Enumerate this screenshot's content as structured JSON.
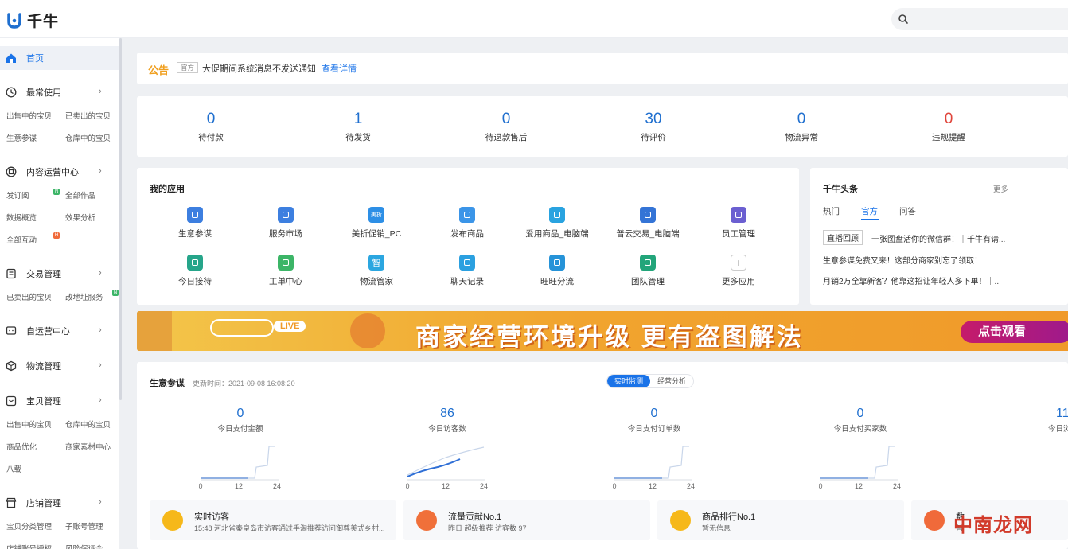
{
  "brand": {
    "name": "千牛"
  },
  "search": {
    "placeholder": ""
  },
  "sidebar": {
    "home": "首页",
    "sections": [
      {
        "title": "最常使用",
        "icon": "clock-icon",
        "items": [
          "出售中的宝贝",
          "已卖出的宝贝",
          "生意参谋",
          "仓库中的宝贝"
        ]
      },
      {
        "title": "内容运营中心",
        "icon": "content-icon",
        "items": [
          "发订阅",
          "全部作品",
          "数据概览",
          "效果分析",
          "全部互动"
        ]
      },
      {
        "title": "交易管理",
        "icon": "order-icon",
        "items": [
          "已卖出的宝贝",
          "改地址服务"
        ]
      },
      {
        "title": "自运营中心",
        "icon": "chat-icon",
        "items": []
      },
      {
        "title": "物流管理",
        "icon": "box-icon",
        "items": []
      },
      {
        "title": "宝贝管理",
        "icon": "goods-icon",
        "items": [
          "出售中的宝贝",
          "仓库中的宝贝",
          "商品优化",
          "商家素材中心",
          "八载"
        ]
      },
      {
        "title": "店铺管理",
        "icon": "store-icon",
        "items": [
          "宝贝分类管理",
          "子账号管理",
          "店铺账号授权",
          "风险保证金"
        ]
      }
    ],
    "badges": {
      "new": "N",
      "hot": "H"
    }
  },
  "notice": {
    "label": "公告",
    "tag": "官方",
    "message": "大促期间系统消息不发送通知",
    "link": "查看详情"
  },
  "stats": [
    {
      "value": "0",
      "label": "待付款"
    },
    {
      "value": "1",
      "label": "待发货"
    },
    {
      "value": "0",
      "label": "待退款售后"
    },
    {
      "value": "30",
      "label": "待评价"
    },
    {
      "value": "0",
      "label": "物流异常"
    },
    {
      "value": "0",
      "label": "违规提醒"
    }
  ],
  "apps": {
    "title": "我的应用",
    "items": [
      {
        "label": "生意参谋",
        "color": "#3d7fe0",
        "icon": "compass-icon"
      },
      {
        "label": "服务市场",
        "color": "#3d7fe0",
        "icon": "bag-icon"
      },
      {
        "label": "美折促销_PC",
        "color": "#2d8fe6",
        "icon": "tag-icon",
        "glyph": "美折"
      },
      {
        "label": "发布商品",
        "color": "#3b95e8",
        "icon": "send-icon"
      },
      {
        "label": "爱用商品_电脑端",
        "color": "#29a3e0",
        "icon": "goods-edit-icon"
      },
      {
        "label": "普云交易_电脑端",
        "color": "#3474d6",
        "icon": "money-icon"
      },
      {
        "label": "员工管理",
        "color": "#6b5fd1",
        "icon": "staff-icon"
      },
      {
        "label": "今日接待",
        "color": "#26a58a",
        "icon": "user-icon"
      },
      {
        "label": "工单中心",
        "color": "#3cb567",
        "icon": "ticket-icon"
      },
      {
        "label": "物流管家",
        "color": "#2ba6e0",
        "icon": "logistics-icon",
        "glyph": "智"
      },
      {
        "label": "聊天记录",
        "color": "#2ba0e0",
        "icon": "chat-record-icon"
      },
      {
        "label": "旺旺分流",
        "color": "#2693d8",
        "icon": "split-icon"
      },
      {
        "label": "团队管理",
        "color": "#22a57a",
        "icon": "team-icon"
      },
      {
        "label": "更多应用",
        "color": "#ffffff",
        "icon": "plus-icon"
      }
    ]
  },
  "news": {
    "title": "千牛头条",
    "more": "更多",
    "tabs": [
      "热门",
      "官方",
      "问答"
    ],
    "active_tab": "官方",
    "items": [
      {
        "tag": "直播回顾",
        "text": "一张图盘活你的微信群！｜千牛有请..."
      },
      {
        "tag": "",
        "text": "生意参谋免费又来！这部分商家别忘了领取！"
      },
      {
        "tag": "",
        "text": "月销2万全靠新客？他靠这招让年轻人多下单！｜..."
      }
    ]
  },
  "banner": {
    "headline": "商家经营环境升级  更有盗图解法",
    "live": "LIVE",
    "cta": "点击观看"
  },
  "business": {
    "title": "生意参谋",
    "updated": "更新时间：2021-09-08 16:08:20",
    "toggle": [
      "实时监测",
      "经营分析"
    ],
    "metrics": [
      {
        "value": "0",
        "label": "今日支付金额"
      },
      {
        "value": "86",
        "label": "今日访客数"
      },
      {
        "value": "0",
        "label": "今日支付订单数"
      },
      {
        "value": "0",
        "label": "今日支付买家数"
      },
      {
        "value": "11",
        "label": "今日浏"
      }
    ],
    "axis_ticks": [
      "0",
      "12",
      "24"
    ],
    "cards": [
      {
        "title": "实时访客",
        "detail": "15:48 河北省秦皇岛市访客通过手淘推荐访问御尊美式乡村...",
        "color": "#f6b81a"
      },
      {
        "title": "流量贡献No.1",
        "detail": "昨日 超级推荐 访客数 97",
        "color": "#f0703a"
      },
      {
        "title": "商品排行No.1",
        "detail": "暂无信息",
        "color": "#f6b81a"
      },
      {
        "title": "数",
        "detail": "暂",
        "color": "#f06a3a"
      }
    ]
  },
  "watermark": "中南龙网"
}
